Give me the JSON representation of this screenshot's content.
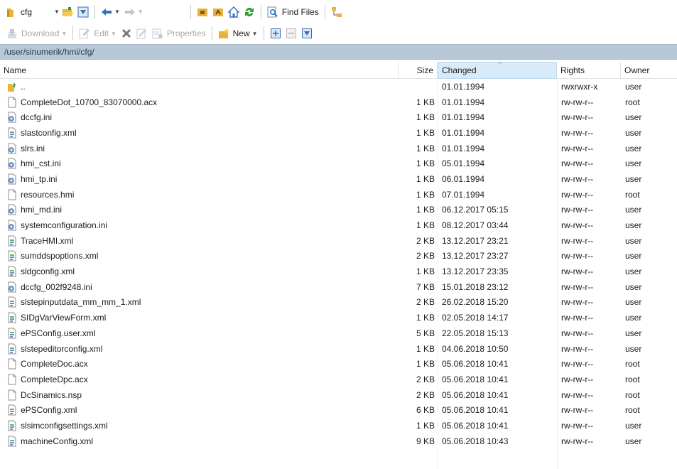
{
  "toolbar_top": {
    "folder_name": "cfg",
    "find_files_label": "Find Files"
  },
  "toolbar_actions": {
    "download_label": "Download",
    "edit_label": "Edit",
    "properties_label": "Properties",
    "new_label": "New"
  },
  "path": "/user/sinumerik/hmi/cfg/",
  "columns": {
    "name": "Name",
    "size": "Size",
    "changed": "Changed",
    "rights": "Rights",
    "owner": "Owner"
  },
  "files": [
    {
      "name": "..",
      "size": "",
      "changed": "01.01.1994",
      "rights": "rwxrwxr-x",
      "owner": "user",
      "icon": "parent-folder-icon"
    },
    {
      "name": "CompleteDot_10700_83070000.acx",
      "size": "1 KB",
      "changed": "01.01.1994",
      "rights": "rw-rw-r--",
      "owner": "root",
      "icon": "blank-file-icon"
    },
    {
      "name": "dccfg.ini",
      "size": "1 KB",
      "changed": "01.01.1994",
      "rights": "rw-rw-r--",
      "owner": "user",
      "icon": "ini-file-icon"
    },
    {
      "name": "slastconfig.xml",
      "size": "1 KB",
      "changed": "01.01.1994",
      "rights": "rw-rw-r--",
      "owner": "user",
      "icon": "xml-file-icon"
    },
    {
      "name": "slrs.ini",
      "size": "1 KB",
      "changed": "01.01.1994",
      "rights": "rw-rw-r--",
      "owner": "user",
      "icon": "ini-file-icon"
    },
    {
      "name": "hmi_cst.ini",
      "size": "1 KB",
      "changed": "05.01.1994",
      "rights": "rw-rw-r--",
      "owner": "user",
      "icon": "ini-file-icon"
    },
    {
      "name": "hmi_tp.ini",
      "size": "1 KB",
      "changed": "06.01.1994",
      "rights": "rw-rw-r--",
      "owner": "user",
      "icon": "ini-file-icon"
    },
    {
      "name": "resources.hmi",
      "size": "1 KB",
      "changed": "07.01.1994",
      "rights": "rw-rw-r--",
      "owner": "root",
      "icon": "blank-file-icon"
    },
    {
      "name": "hmi_md.ini",
      "size": "1 KB",
      "changed": "06.12.2017 05:15",
      "rights": "rw-rw-r--",
      "owner": "user",
      "icon": "ini-file-icon"
    },
    {
      "name": "systemconfiguration.ini",
      "size": "1 KB",
      "changed": "08.12.2017 03:44",
      "rights": "rw-rw-r--",
      "owner": "user",
      "icon": "ini-file-icon"
    },
    {
      "name": "TraceHMI.xml",
      "size": "2 KB",
      "changed": "13.12.2017 23:21",
      "rights": "rw-rw-r--",
      "owner": "user",
      "icon": "xml-file-icon"
    },
    {
      "name": "sumddspoptions.xml",
      "size": "2 KB",
      "changed": "13.12.2017 23:27",
      "rights": "rw-rw-r--",
      "owner": "user",
      "icon": "xml-file-icon"
    },
    {
      "name": "sldgconfig.xml",
      "size": "1 KB",
      "changed": "13.12.2017 23:35",
      "rights": "rw-rw-r--",
      "owner": "user",
      "icon": "xml-file-icon"
    },
    {
      "name": "dccfg_002f9248.ini",
      "size": "7 KB",
      "changed": "15.01.2018 23:12",
      "rights": "rw-rw-r--",
      "owner": "user",
      "icon": "ini-file-icon"
    },
    {
      "name": "slstepinputdata_mm_mm_1.xml",
      "size": "2 KB",
      "changed": "26.02.2018 15:20",
      "rights": "rw-rw-r--",
      "owner": "user",
      "icon": "xml-file-icon"
    },
    {
      "name": "SIDgVarViewForm.xml",
      "size": "1 KB",
      "changed": "02.05.2018 14:17",
      "rights": "rw-rw-r--",
      "owner": "user",
      "icon": "xml-file-icon"
    },
    {
      "name": "ePSConfig.user.xml",
      "size": "5 KB",
      "changed": "22.05.2018 15:13",
      "rights": "rw-rw-r--",
      "owner": "user",
      "icon": "xml-file-icon"
    },
    {
      "name": "slstepeditorconfig.xml",
      "size": "1 KB",
      "changed": "04.06.2018 10:50",
      "rights": "rw-rw-r--",
      "owner": "user",
      "icon": "xml-file-icon"
    },
    {
      "name": "CompleteDoc.acx",
      "size": "1 KB",
      "changed": "05.06.2018 10:41",
      "rights": "rw-rw-r--",
      "owner": "root",
      "icon": "blank-file-icon"
    },
    {
      "name": "CompleteDpc.acx",
      "size": "2 KB",
      "changed": "05.06.2018 10:41",
      "rights": "rw-rw-r--",
      "owner": "root",
      "icon": "blank-file-icon"
    },
    {
      "name": "DcSinamics.nsp",
      "size": "2 KB",
      "changed": "05.06.2018 10:41",
      "rights": "rw-rw-r--",
      "owner": "root",
      "icon": "blank-file-icon"
    },
    {
      "name": "ePSConfig.xml",
      "size": "6 KB",
      "changed": "05.06.2018 10:41",
      "rights": "rw-rw-r--",
      "owner": "root",
      "icon": "xml-file-icon"
    },
    {
      "name": "slsimconfigsettings.xml",
      "size": "1 KB",
      "changed": "05.06.2018 10:41",
      "rights": "rw-rw-r--",
      "owner": "user",
      "icon": "xml-file-icon"
    },
    {
      "name": "machineConfig.xml",
      "size": "9 KB",
      "changed": "05.06.2018 10:43",
      "rights": "rw-rw-r--",
      "owner": "user",
      "icon": "xml-file-icon"
    }
  ],
  "colors": {
    "path_bar": "#b8c8d7",
    "sorted_header": "#d9ebf9",
    "folder_yellow": "#e8b33c",
    "refresh_green": "#2f9e2f",
    "nav_blue": "#2f6fc4"
  }
}
